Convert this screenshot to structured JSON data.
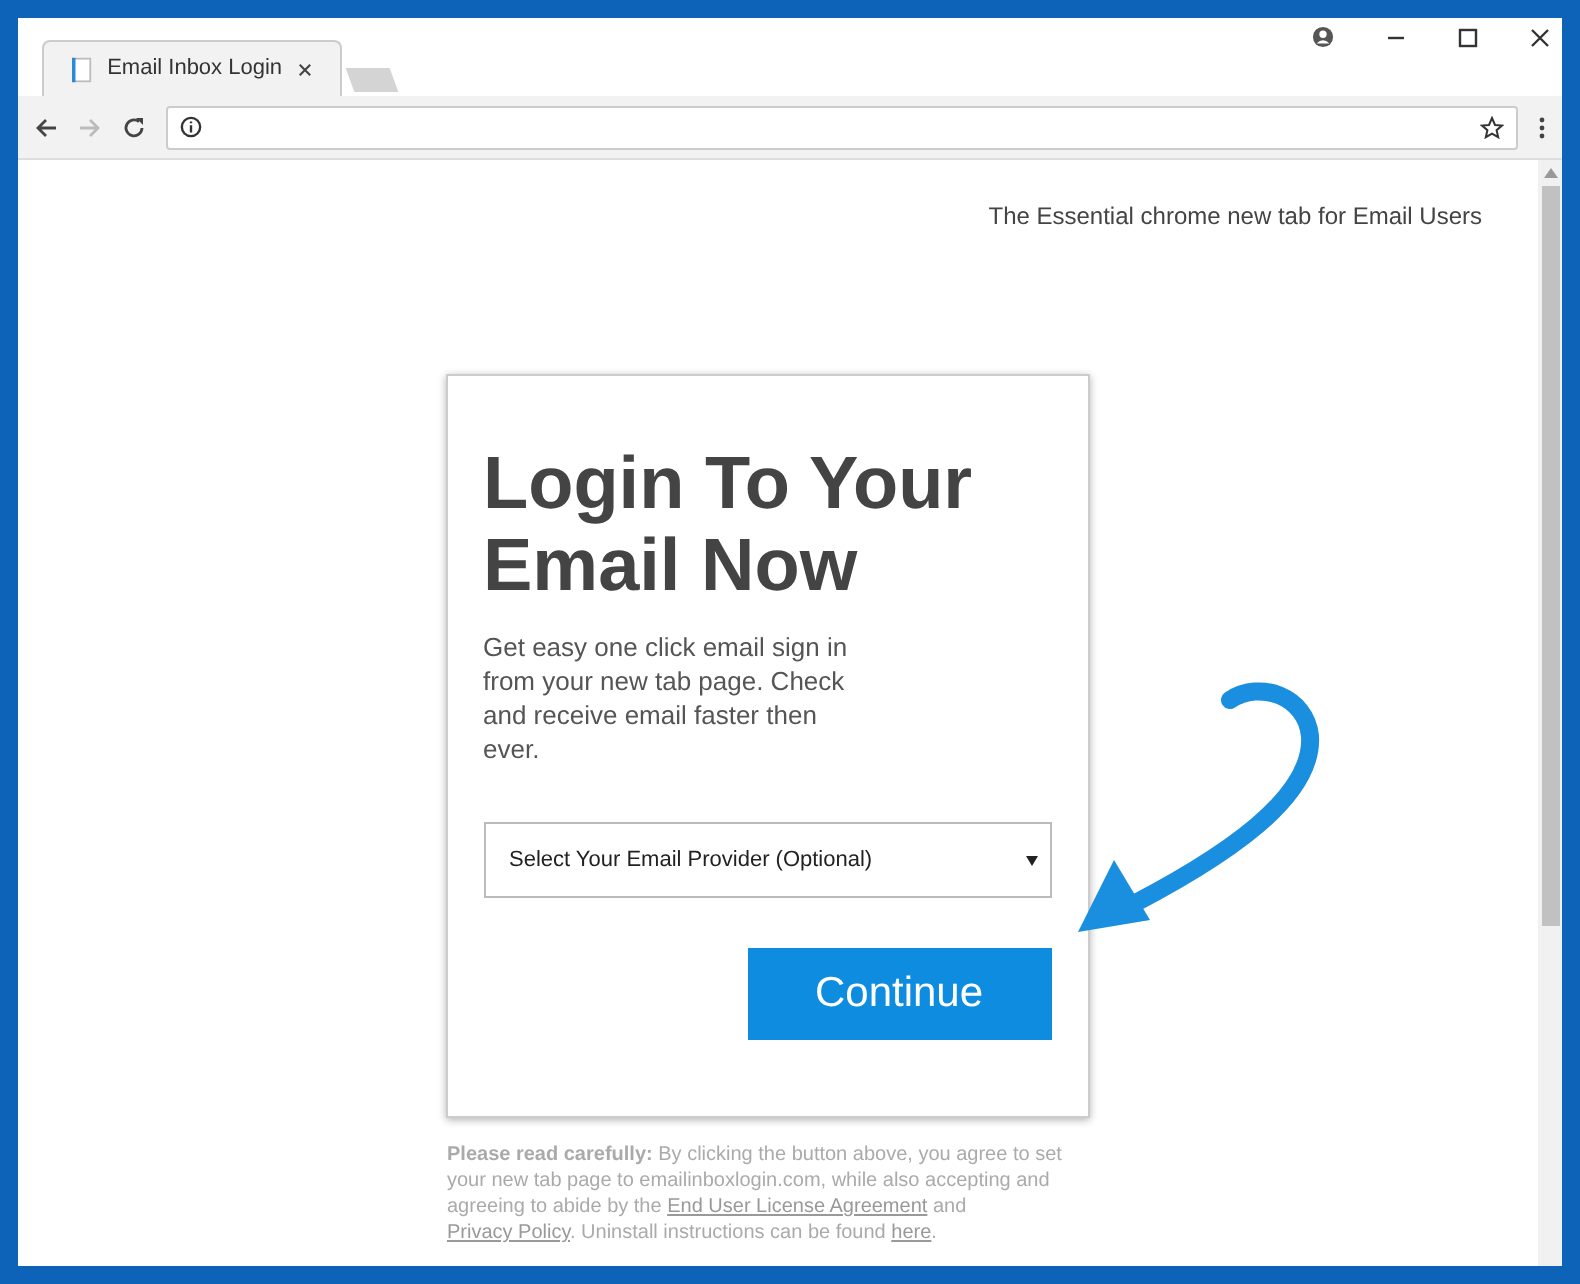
{
  "browser": {
    "tab": {
      "title": "Email Inbox Login",
      "selected": true
    }
  },
  "page": {
    "tagline": "The Essential chrome new tab for Email Users",
    "card": {
      "heading": "Login To Your Email Now",
      "description": "Get easy one click email sign in from your new tab page. Check and receive email faster then ever.",
      "select": {
        "value": "Select Your Email Provider (Optional)"
      },
      "button": "Continue"
    },
    "disclaimer": [
      {
        "kind": "text",
        "text": "**Please read carefully:** By clicking the button above, you agree to set your new tab page to emailinboxlogin.com, while also accepting and agreeing to abide by the "
      },
      {
        "kind": "link",
        "text": "End User License Agreement"
      },
      {
        "kind": "text",
        "text": " and "
      },
      {
        "kind": "link",
        "text": "Privacy Policy"
      },
      {
        "kind": "text",
        "text": ". Uninstall instructions can be found "
      },
      {
        "kind": "link",
        "text": "here"
      },
      {
        "kind": "text",
        "text": "."
      }
    ]
  }
}
